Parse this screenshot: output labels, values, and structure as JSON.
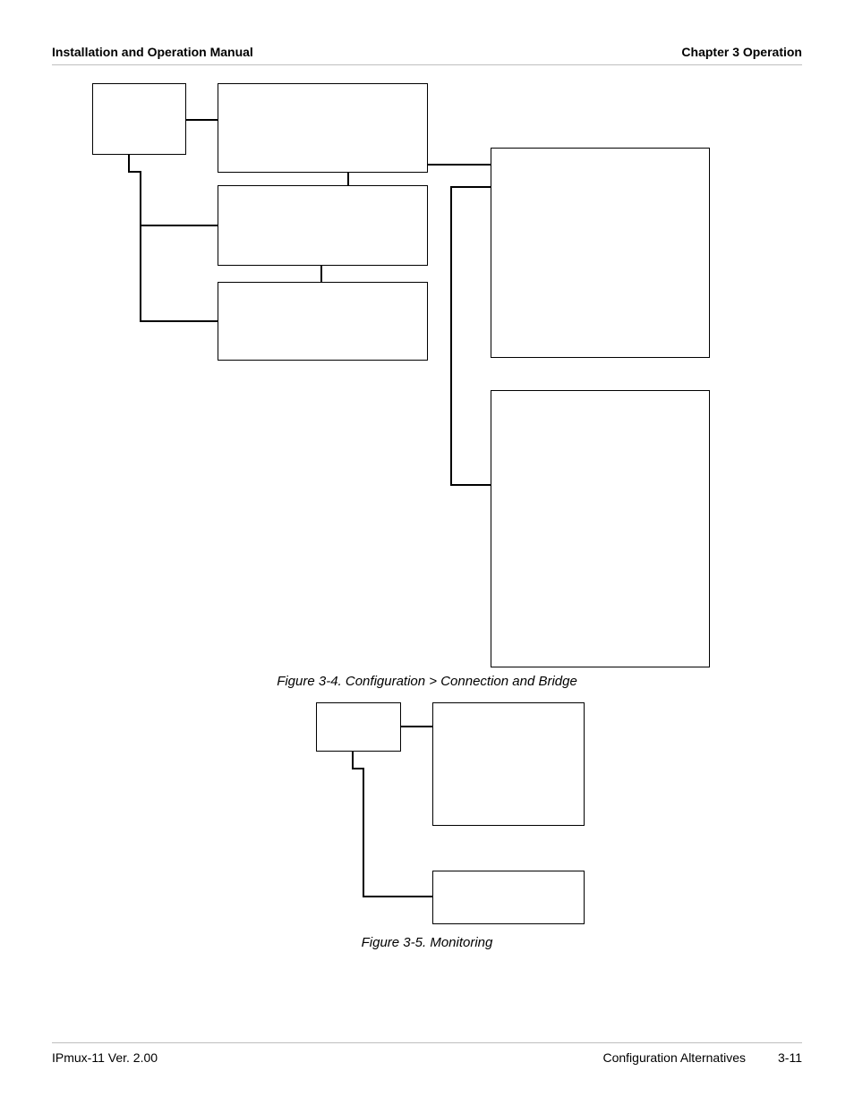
{
  "header": {
    "left": "Installation and Operation Manual",
    "right": "Chapter 3  Operation"
  },
  "captions": {
    "fig34": "Figure 3-4.  Configuration > Connection and Bridge",
    "fig35": "Figure 3-5.  Monitoring"
  },
  "footer": {
    "left": "IPmux-11 Ver. 2.00",
    "right_label": "Configuration Alternatives",
    "page": "3-11"
  }
}
